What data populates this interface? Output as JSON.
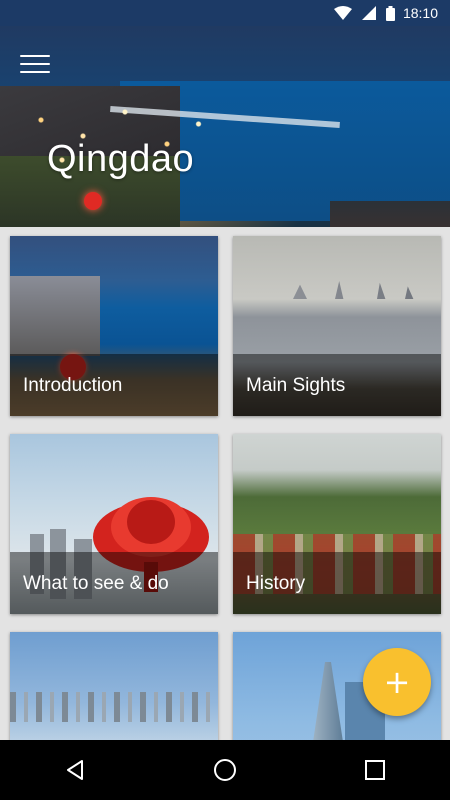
{
  "status_bar": {
    "time": "18:10",
    "icons": [
      "wifi-icon",
      "signal-icon",
      "battery-icon"
    ]
  },
  "header": {
    "title": "Qingdao",
    "menu_icon": "hamburger-menu-icon"
  },
  "cards": [
    {
      "label": "Introduction"
    },
    {
      "label": "Main Sights"
    },
    {
      "label": "What to see & do"
    },
    {
      "label": "History"
    },
    {
      "label": ""
    },
    {
      "label": ""
    }
  ],
  "fab": {
    "icon": "plus-icon",
    "symbol": "+",
    "color": "#f9c02e"
  },
  "nav_bar": {
    "icons": [
      "back-icon",
      "home-icon",
      "recents-icon"
    ]
  },
  "colors": {
    "status_bar": "#1c3a66",
    "background": "#e3e3e3",
    "fab": "#f9c02e"
  }
}
